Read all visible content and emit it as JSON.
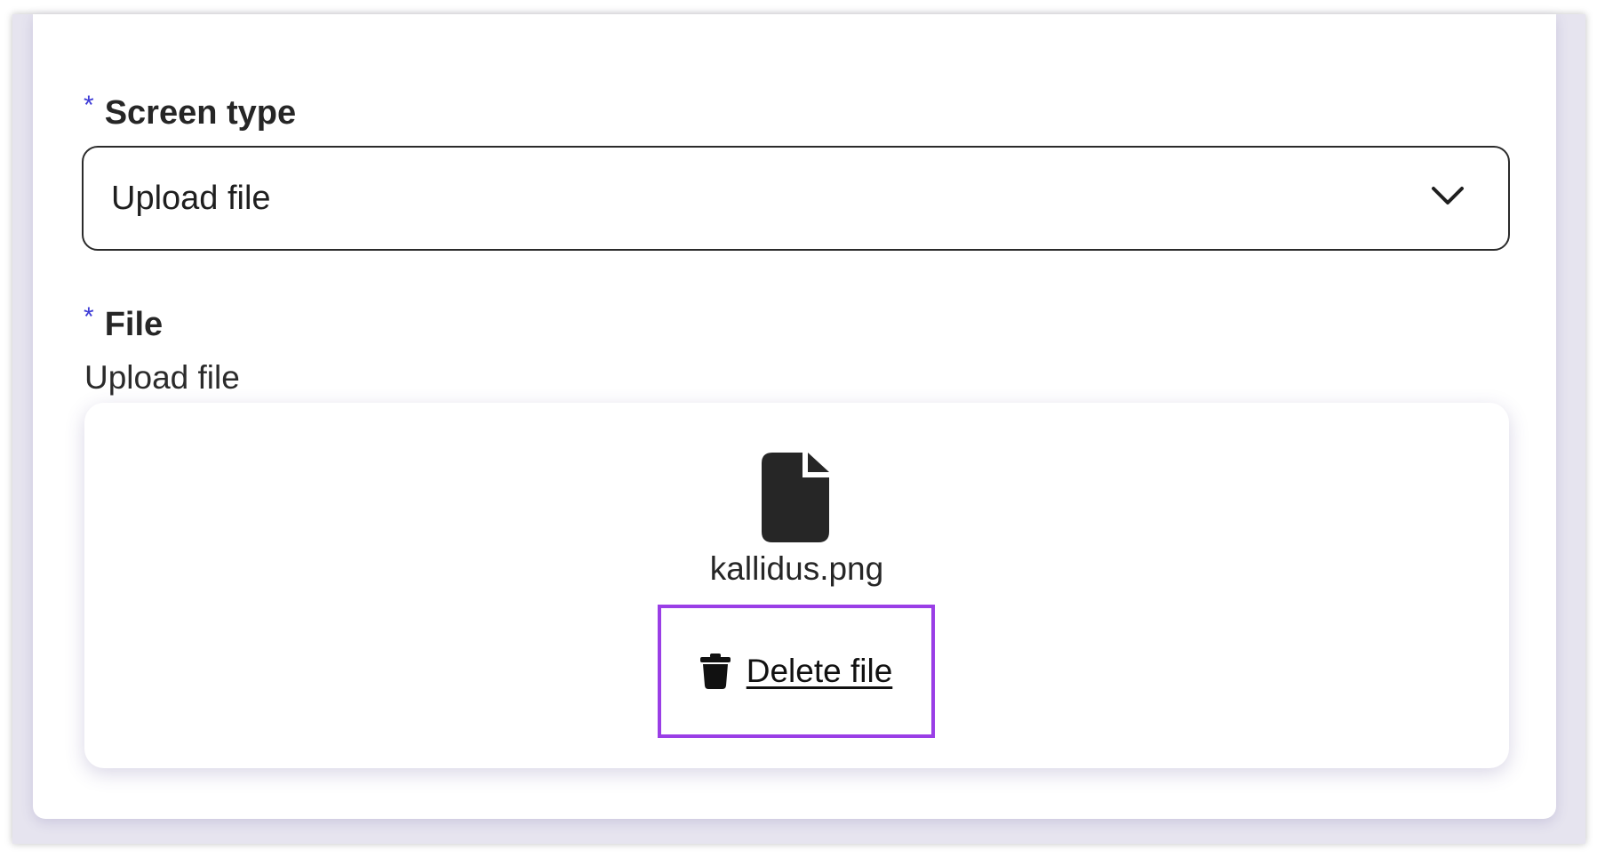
{
  "form": {
    "screen_type": {
      "label": "Screen type",
      "required_mark": "*",
      "selected_value": "Upload file"
    },
    "file": {
      "label": "File",
      "required_mark": "*",
      "helper_text": "Upload file",
      "uploaded_file_name": "kallidus.png",
      "delete_label": "Delete file"
    }
  },
  "icons": {
    "select_chevron": "chevron-down-icon",
    "file": "file-icon",
    "delete": "trash-icon"
  },
  "colors": {
    "required_star": "#3d3bd6",
    "focus_outline": "#9a3ee6"
  }
}
